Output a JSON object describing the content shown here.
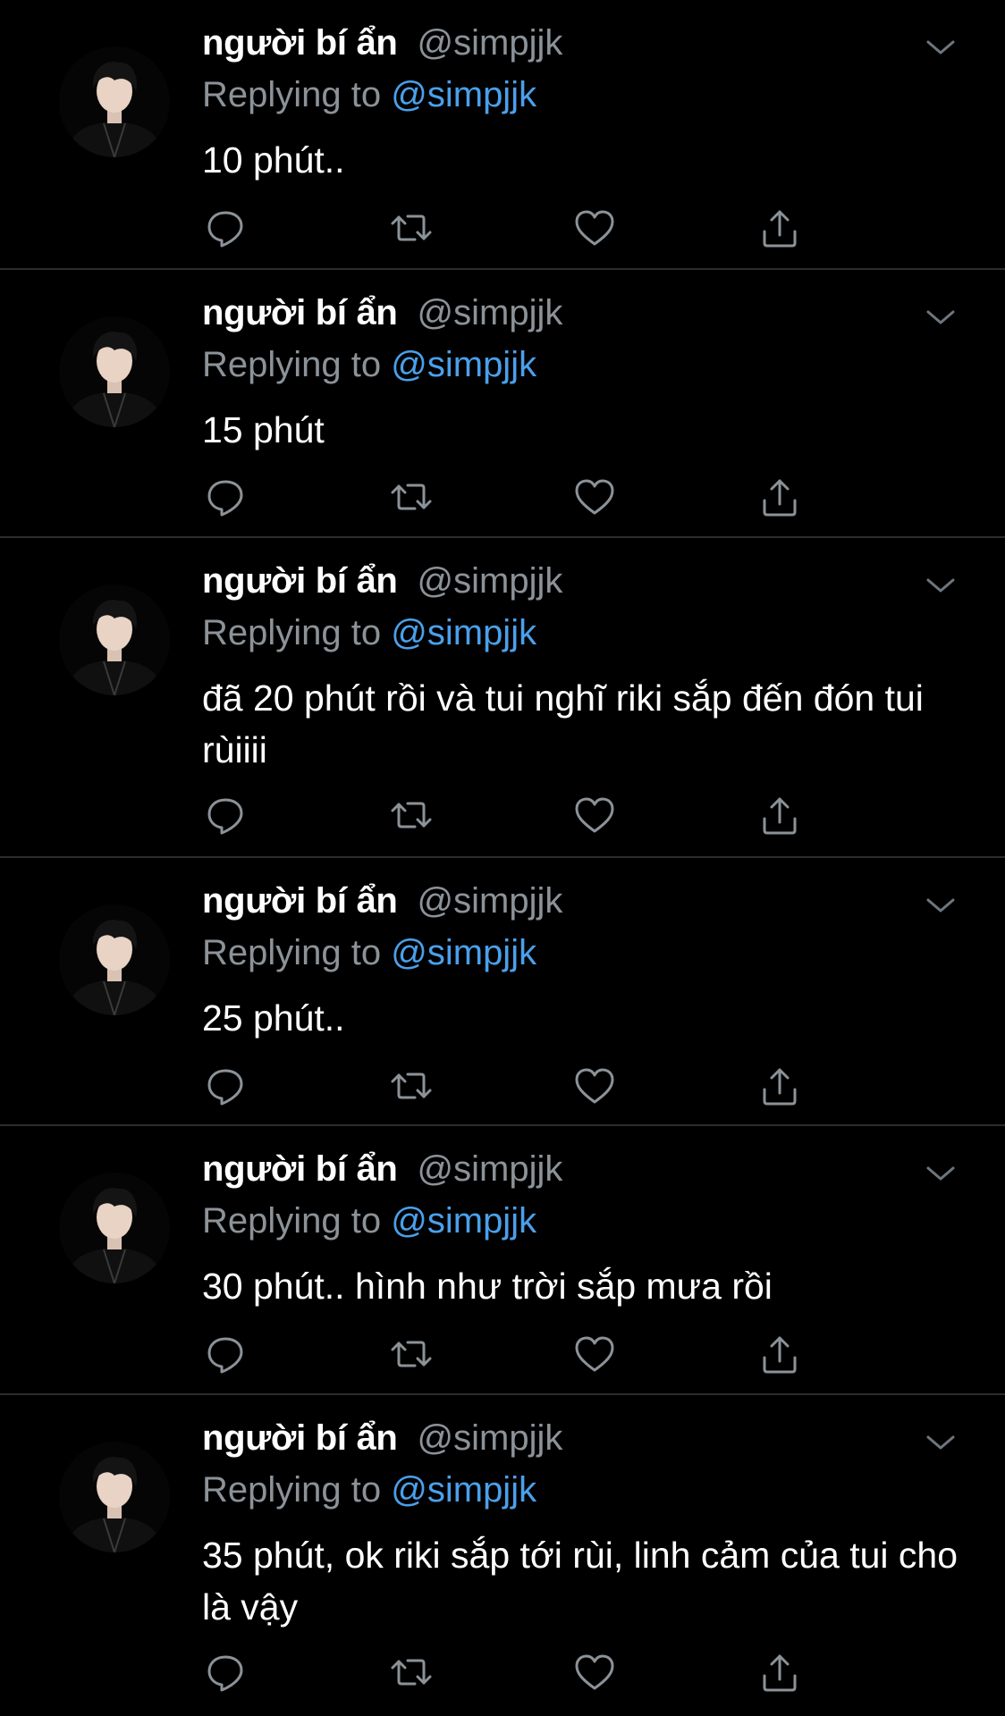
{
  "tweets": [
    {
      "display_name": "người bí ẩn",
      "handle": "@simpjjk",
      "reply_prefix": "Replying to",
      "reply_handle": "@simpjjk",
      "text": "10 phút.."
    },
    {
      "display_name": "người bí ẩn",
      "handle": "@simpjjk",
      "reply_prefix": "Replying to",
      "reply_handle": "@simpjjk",
      "text": "15 phút"
    },
    {
      "display_name": "người bí ẩn",
      "handle": "@simpjjk",
      "reply_prefix": "Replying to",
      "reply_handle": "@simpjjk",
      "text": "đã 20 phút rồi và tui nghĩ riki sắp đến đón tui rùiiii"
    },
    {
      "display_name": "người bí ẩn",
      "handle": "@simpjjk",
      "reply_prefix": "Replying to",
      "reply_handle": "@simpjjk",
      "text": "25 phút.."
    },
    {
      "display_name": "người bí ẩn",
      "handle": "@simpjjk",
      "reply_prefix": "Replying to",
      "reply_handle": "@simpjjk",
      "text": "30 phút.. hình như trời sắp mưa rồi"
    },
    {
      "display_name": "người bí ẩn",
      "handle": "@simpjjk",
      "reply_prefix": "Replying to",
      "reply_handle": "@simpjjk",
      "text": "35 phút, ok riki sắp tới rùi, linh cảm của tui cho là vậy"
    }
  ],
  "icons": {
    "reply": "reply-icon",
    "retweet": "retweet-icon",
    "like": "heart-icon",
    "share": "share-icon",
    "more": "chevron-down-icon"
  },
  "colors": {
    "background": "#000000",
    "primary_text": "#ffffff",
    "secondary_text": "#8b9298",
    "link": "#4aa0eb",
    "divider": "#2a2d30",
    "icon": "#8b9298"
  }
}
